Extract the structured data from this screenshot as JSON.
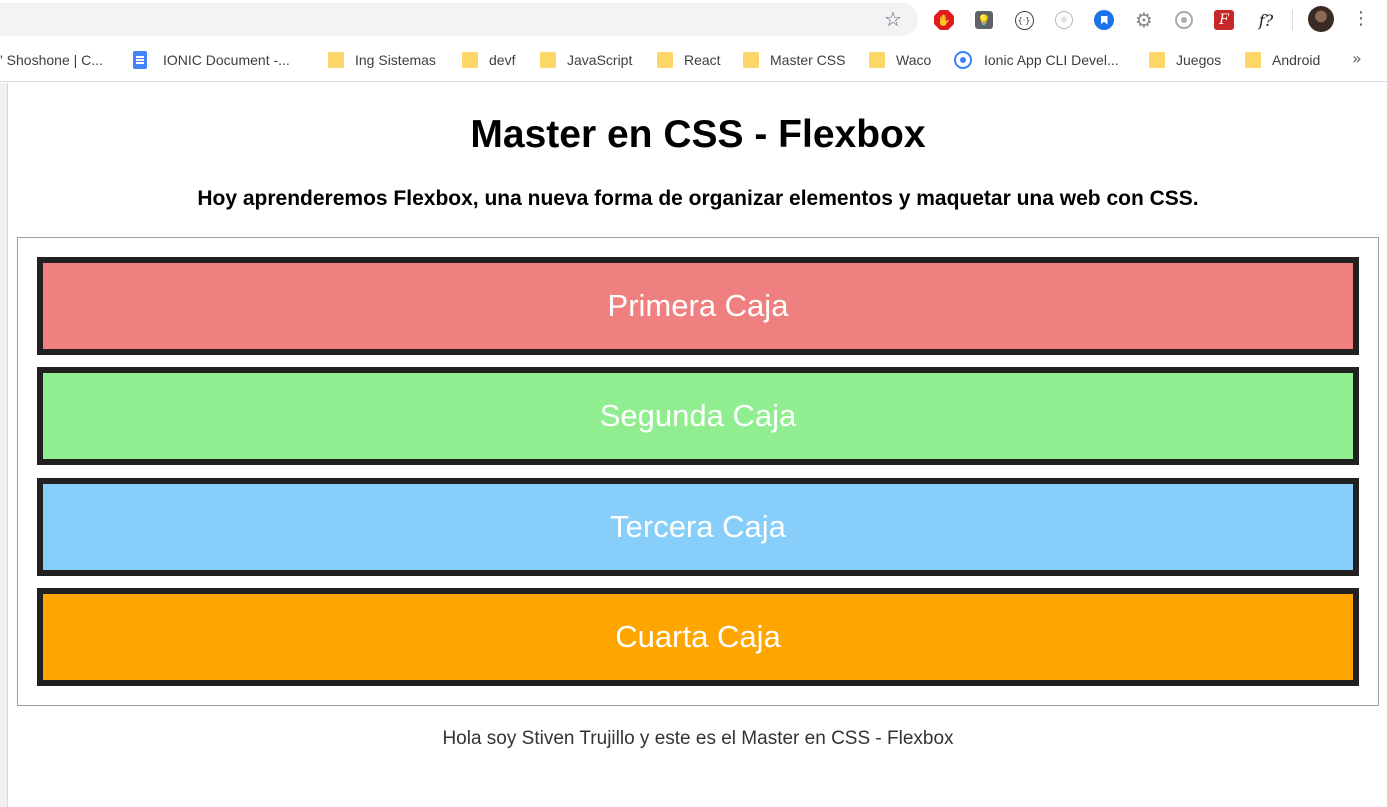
{
  "browser": {
    "extensions": [
      {
        "name": "adblock-icon",
        "glyph": "✋"
      },
      {
        "name": "lightbulb-icon",
        "glyph": "💡"
      },
      {
        "name": "code-inspector-icon",
        "glyph": "{·}"
      },
      {
        "name": "react-devtools-icon",
        "glyph": "⚛"
      },
      {
        "name": "bookmark-manager-icon"
      },
      {
        "name": "gear-extension-icon",
        "glyph": "⚙"
      },
      {
        "name": "target-extension-icon"
      },
      {
        "name": "font-extension-icon",
        "glyph": "F"
      },
      {
        "name": "whatfont-icon",
        "glyph": "f?"
      }
    ],
    "menu_glyph": "⋮",
    "star_glyph": "☆",
    "bookmarks_more": "»",
    "bookmarks": [
      {
        "label": "l' Shoshone | C...",
        "icon": "none"
      },
      {
        "label": "IONIC Document -...",
        "icon": "docs"
      },
      {
        "label": "Ing Sistemas",
        "icon": "folder"
      },
      {
        "label": "devf",
        "icon": "folder"
      },
      {
        "label": "JavaScript",
        "icon": "folder"
      },
      {
        "label": "React",
        "icon": "folder"
      },
      {
        "label": "Master CSS",
        "icon": "folder"
      },
      {
        "label": "Waco",
        "icon": "folder"
      },
      {
        "label": "Ionic App CLI Devel...",
        "icon": "ionic"
      },
      {
        "label": "Juegos",
        "icon": "folder"
      },
      {
        "label": "Android",
        "icon": "folder"
      }
    ]
  },
  "page": {
    "title": "Master en CSS - Flexbox",
    "subtitle": "Hoy aprenderemos Flexbox, una nueva forma de organizar elementos y maquetar una web con CSS.",
    "boxes": [
      {
        "label": "Primera Caja",
        "color": "#f08080"
      },
      {
        "label": "Segunda Caja",
        "color": "#90ee90"
      },
      {
        "label": "Tercera Caja",
        "color": "#87cefa"
      },
      {
        "label": "Cuarta Caja",
        "color": "#ffa500"
      }
    ],
    "footer": "Hola soy Stiven Trujillo y este es el Master en CSS - Flexbox"
  }
}
